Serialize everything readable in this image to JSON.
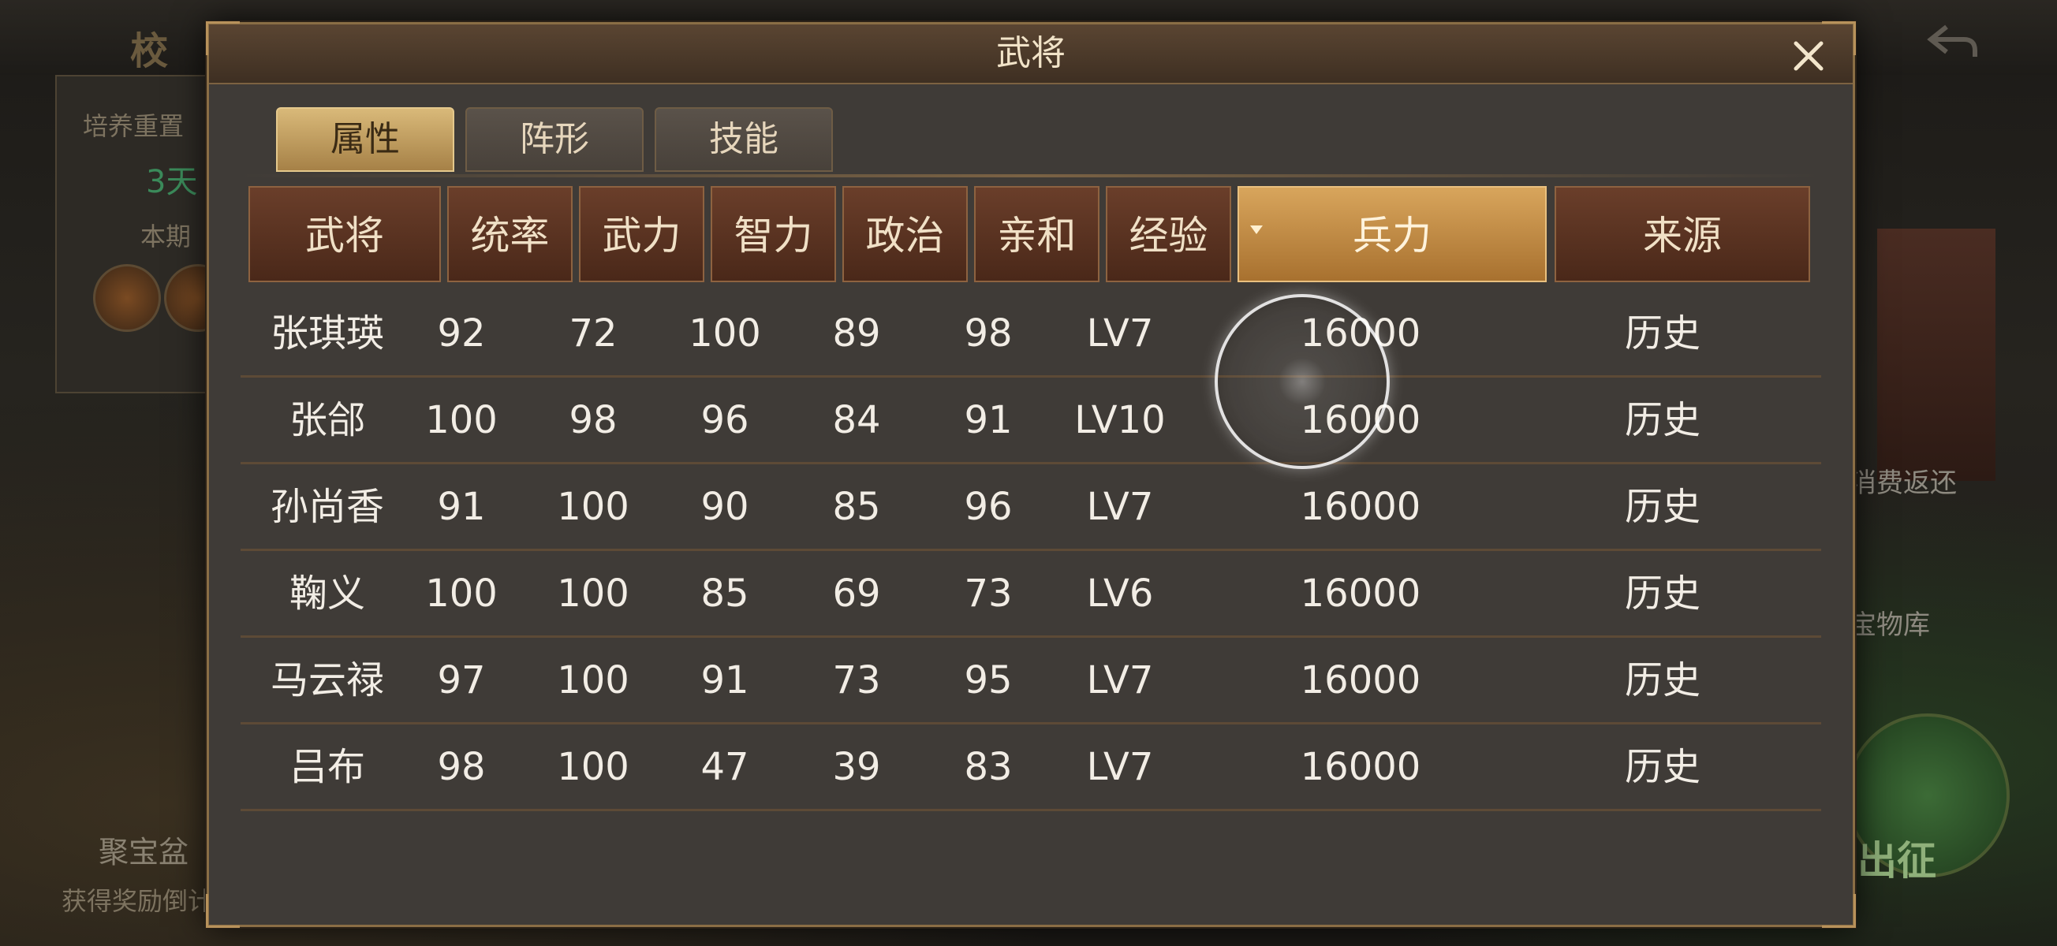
{
  "background": {
    "left_title": "校",
    "panel_lines": [
      "培养重置",
      "3天",
      "本期"
    ],
    "treasure_label": "聚宝盆",
    "treasure_sub": "获得奖励倒计",
    "right_labels": [
      "消费返还",
      "宝物库"
    ],
    "go_button": "出征"
  },
  "dialog": {
    "title": "武将",
    "close_label": "X",
    "tabs": [
      "属性",
      "阵形",
      "技能"
    ],
    "active_tab": 0,
    "columns": [
      "武将",
      "统率",
      "武力",
      "智力",
      "政治",
      "亲和",
      "经验",
      "兵力",
      "来源"
    ],
    "sorted_column": "兵力",
    "rows": [
      [
        "张琪瑛",
        "92",
        "72",
        "100",
        "89",
        "98",
        "LV7",
        "16000",
        "历史"
      ],
      [
        "张郃",
        "100",
        "98",
        "96",
        "84",
        "91",
        "LV10",
        "16000",
        "历史"
      ],
      [
        "孙尚香",
        "91",
        "100",
        "90",
        "85",
        "96",
        "LV7",
        "16000",
        "历史"
      ],
      [
        "鞠义",
        "100",
        "100",
        "85",
        "69",
        "73",
        "LV6",
        "16000",
        "历史"
      ],
      [
        "马云禄",
        "97",
        "100",
        "91",
        "73",
        "95",
        "LV7",
        "16000",
        "历史"
      ],
      [
        "吕布",
        "98",
        "100",
        "47",
        "39",
        "83",
        "LV7",
        "16000",
        "历史"
      ]
    ]
  },
  "colors": {
    "header_bg": "#5a3322",
    "sorted_header_bg": "#c48d45",
    "active_tab_bg": "#c9a464",
    "dialog_bg": "#3f3b37",
    "text": "#f2ede5"
  }
}
